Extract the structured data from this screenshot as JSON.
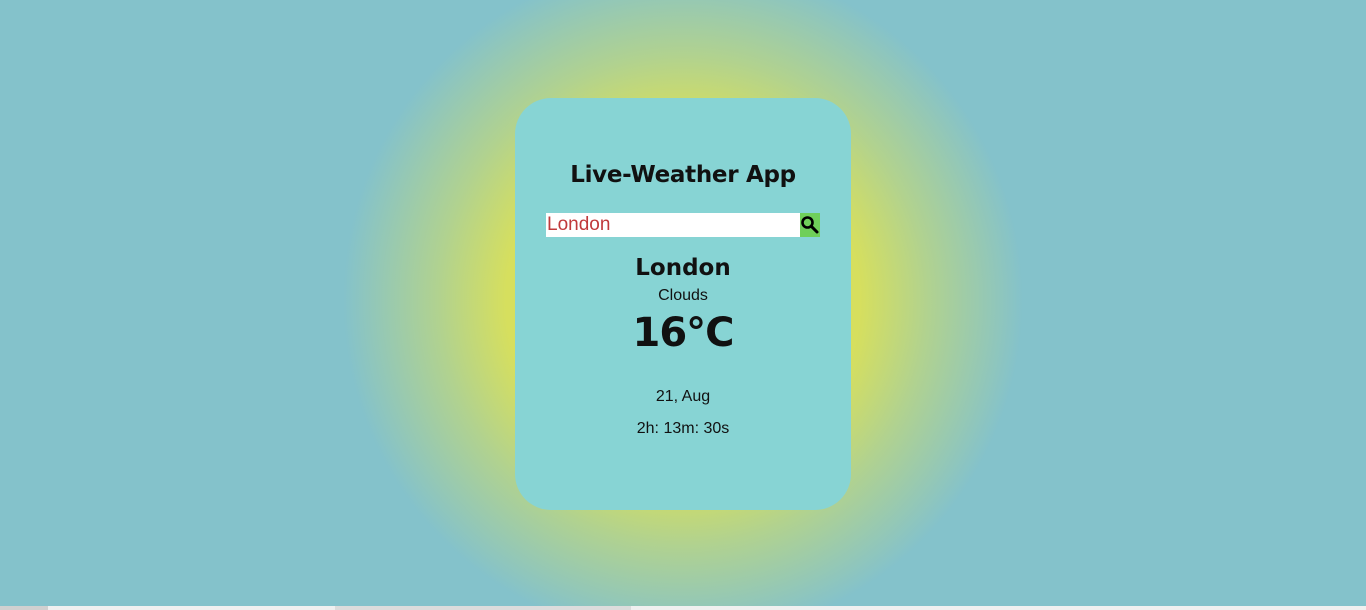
{
  "app": {
    "title": "Live-Weather App"
  },
  "search": {
    "value": "London",
    "button_icon": "search-icon"
  },
  "weather": {
    "city": "London",
    "condition": "Clouds",
    "temperature": "16",
    "unit": "°C",
    "date": "21, Aug",
    "time": "2h: 13m: 30s"
  },
  "colors": {
    "background": "#84c2cb",
    "glow": "#d6df5e",
    "card": "#87d4d4",
    "search_button": "#6fcf5a",
    "input_text": "#c0393b"
  }
}
